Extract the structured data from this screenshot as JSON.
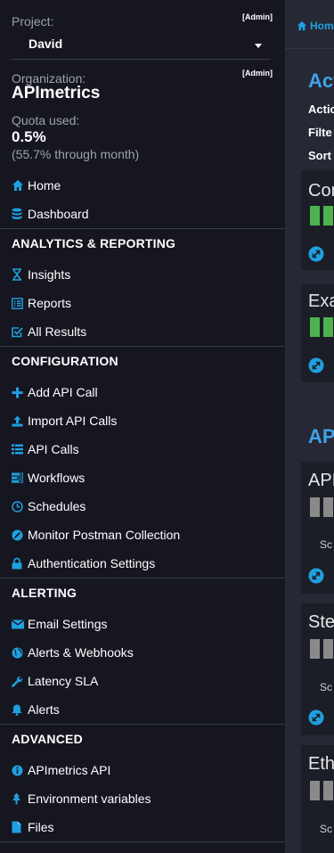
{
  "sidebar": {
    "project_label": "Project:",
    "project_admin": "[Admin]",
    "project_value": "David",
    "org_label": "Organization:",
    "org_admin": "[Admin]",
    "org_name": "APImetrics",
    "quota_label": "Quota used:",
    "quota_value": "0.5%",
    "quota_sub": "(55.7% through month)",
    "top_items": [
      {
        "label": "Home",
        "icon": "home-icon"
      },
      {
        "label": "Dashboard",
        "icon": "database-icon"
      }
    ],
    "sections": [
      {
        "title": "ANALYTICS & REPORTING",
        "items": [
          {
            "label": "Insights",
            "icon": "hourglass-icon"
          },
          {
            "label": "Reports",
            "icon": "list-alt-icon"
          },
          {
            "label": "All Results",
            "icon": "check-square-icon"
          }
        ]
      },
      {
        "title": "CONFIGURATION",
        "items": [
          {
            "label": "Add API Call",
            "icon": "plus-icon"
          },
          {
            "label": "Import API Calls",
            "icon": "upload-icon"
          },
          {
            "label": "API Calls",
            "icon": "list-icon"
          },
          {
            "label": "Workflows",
            "icon": "tasks-icon"
          },
          {
            "label": "Schedules",
            "icon": "clock-icon"
          },
          {
            "label": "Monitor Postman Collection",
            "icon": "postman-icon"
          },
          {
            "label": "Authentication Settings",
            "icon": "lock-icon"
          }
        ]
      },
      {
        "title": "ALERTING",
        "items": [
          {
            "label": "Email Settings",
            "icon": "envelope-icon"
          },
          {
            "label": "Alerts & Webhooks",
            "icon": "globe-icon"
          },
          {
            "label": "Latency SLA",
            "icon": "wrench-icon"
          },
          {
            "label": "Alerts",
            "icon": "bell-icon"
          }
        ]
      },
      {
        "title": "ADVANCED",
        "items": [
          {
            "label": "APImetrics API",
            "icon": "info-circle-icon"
          },
          {
            "label": "Environment variables",
            "icon": "tree-icon"
          },
          {
            "label": "Files",
            "icon": "file-icon"
          }
        ]
      }
    ]
  },
  "main": {
    "breadcrumb": "Hom",
    "heading_1": "Acti",
    "row_action": "Actio",
    "row_filter": "Filte",
    "row_sort": "Sort",
    "cards_1": [
      {
        "title": "Cor",
        "link": "N"
      },
      {
        "title": "Exa",
        "link": "N"
      }
    ],
    "heading_2": "API",
    "cards_2": [
      {
        "title": "API",
        "sub": "Sc",
        "link": "N"
      },
      {
        "title": "Ste",
        "sub": "Sc",
        "link": "N"
      },
      {
        "title": "Eth",
        "sub": "Sc"
      }
    ],
    "colors": {
      "accent": "#1fa0e0",
      "ok": "#4cb24f",
      "idle": "#8a8a8a"
    }
  }
}
